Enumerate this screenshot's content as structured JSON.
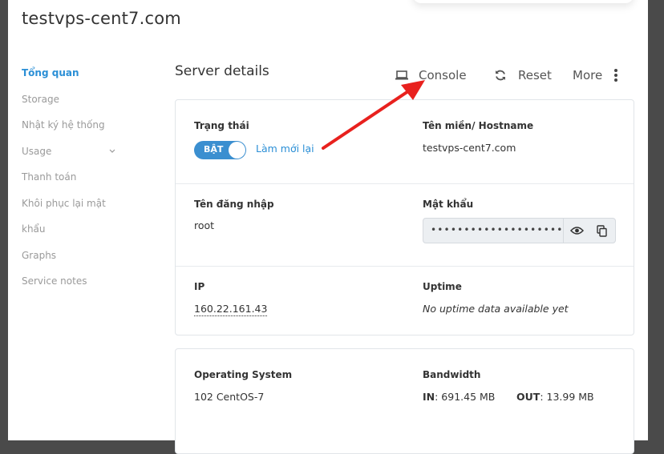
{
  "page": {
    "title": "testvps-cent7.com"
  },
  "sidebar": {
    "items": [
      {
        "label": "Tổng quan",
        "active": true
      },
      {
        "label": "Storage"
      },
      {
        "label": "Nhật ký hệ thống"
      },
      {
        "label": "Usage",
        "chevron": "chevron-down-icon"
      },
      {
        "label": "Thanh toán"
      },
      {
        "label": "Khôi phục lại mật"
      },
      {
        "label": "khẩu"
      },
      {
        "label": "Graphs"
      },
      {
        "label": "Service notes"
      }
    ]
  },
  "main": {
    "section_title": "Server details",
    "actions": {
      "console": {
        "label": "Console",
        "icon": "laptop-icon"
      },
      "reset": {
        "label": "Reset",
        "icon": "refresh-icon"
      },
      "more": {
        "label": "More",
        "icon": "kebab-menu-icon"
      }
    },
    "details": {
      "status": {
        "label": "Trạng thái",
        "toggle_text": "BẬT",
        "toggle_on": true,
        "refresh_link": "Làm mới lại"
      },
      "hostname": {
        "label": "Tên miền/ Hostname",
        "value": "testvps-cent7.com"
      },
      "username": {
        "label": "Tên đăng nhập",
        "value": "root"
      },
      "password": {
        "label": "Mật khẩu",
        "masked": "••••••••••••••••••••",
        "show_icon": "eye-icon",
        "copy_icon": "copy-icon"
      },
      "ip": {
        "label": "IP",
        "value": "160.22.161.43"
      },
      "uptime": {
        "label": "Uptime",
        "value": "No uptime data available yet"
      }
    },
    "system": {
      "os": {
        "label": "Operating System",
        "value": "102 CentOS-7"
      },
      "bandwidth": {
        "label": "Bandwidth",
        "in_label": "IN",
        "in_value": ": 691.45 MB",
        "out_label": "OUT",
        "out_value": ": 13.99 MB"
      }
    }
  },
  "colors": {
    "accent": "#2b8fd6",
    "toggle": "#3b8fd0",
    "annotation_arrow": "#e8211e"
  }
}
